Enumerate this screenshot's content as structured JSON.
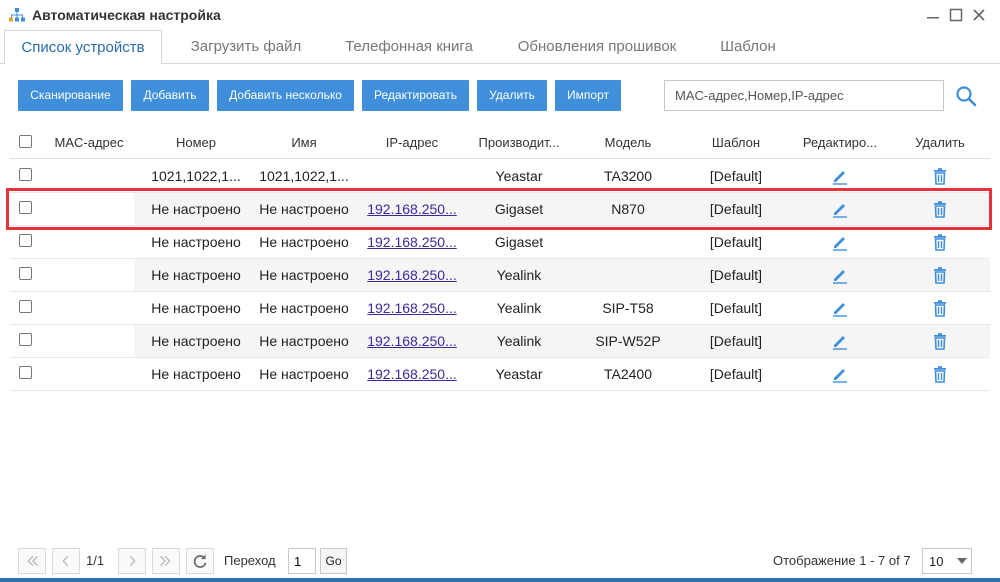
{
  "window": {
    "title": "Автоматическая настройка"
  },
  "tabs": [
    {
      "label": "Список устройств",
      "active": true
    },
    {
      "label": "Загрузить файл"
    },
    {
      "label": "Телефонная книга"
    },
    {
      "label": "Обновления прошивок"
    },
    {
      "label": "Шаблон"
    }
  ],
  "toolbar": {
    "scan": "Сканирование",
    "add": "Добавить",
    "add_multiple": "Добавить несколько",
    "edit": "Редактировать",
    "delete": "Удалить",
    "import": "Импорт",
    "search_placeholder": "MAC-адрес,Номер,IP-адрес",
    "accent_color": "#3f8fdb"
  },
  "table": {
    "headers": {
      "mac": "MAC-адрес",
      "number": "Номер",
      "name": "Имя",
      "ip": "IP-адрес",
      "manufacturer": "Производит...",
      "model": "Модель",
      "template": "Шаблон",
      "edit": "Редактиро...",
      "delete": "Удалить"
    },
    "rows": [
      {
        "mac": "",
        "number": "1021,1022,1...",
        "name": "1021,1022,1...",
        "ip": "",
        "manufacturer": "Yeastar",
        "model": "TA3200",
        "template": "[Default]"
      },
      {
        "mac": "",
        "number": "Не настроено",
        "name": "Не настроено",
        "ip": "192.168.250...",
        "manufacturer": "Gigaset",
        "model": "N870",
        "template": "[Default]"
      },
      {
        "mac": "",
        "number": "Не настроено",
        "name": "Не настроено",
        "ip": "192.168.250...",
        "manufacturer": "Gigaset",
        "model": "",
        "template": "[Default]"
      },
      {
        "mac": "",
        "number": "Не настроено",
        "name": "Не настроено",
        "ip": "192.168.250...",
        "manufacturer": "Yealink",
        "model": "",
        "template": "[Default]"
      },
      {
        "mac": "",
        "number": "Не настроено",
        "name": "Не настроено",
        "ip": "192.168.250...",
        "manufacturer": "Yealink",
        "model": "SIP-T58",
        "template": "[Default]"
      },
      {
        "mac": "",
        "number": "Не настроено",
        "name": "Не настроено",
        "ip": "192.168.250...",
        "manufacturer": "Yealink",
        "model": "SIP-W52P",
        "template": "[Default]"
      },
      {
        "mac": "",
        "number": "Не настроено",
        "name": "Не настроено",
        "ip": "192.168.250...",
        "manufacturer": "Yeastar",
        "model": "TA2400",
        "template": "[Default]"
      }
    ],
    "highlight_color": "#e4333a"
  },
  "pager": {
    "page_info": "1/1",
    "goto_label": "Переход",
    "goto_value": "1",
    "go": "Go",
    "display": "Отображение 1 - 7 of 7",
    "page_size": "10"
  }
}
